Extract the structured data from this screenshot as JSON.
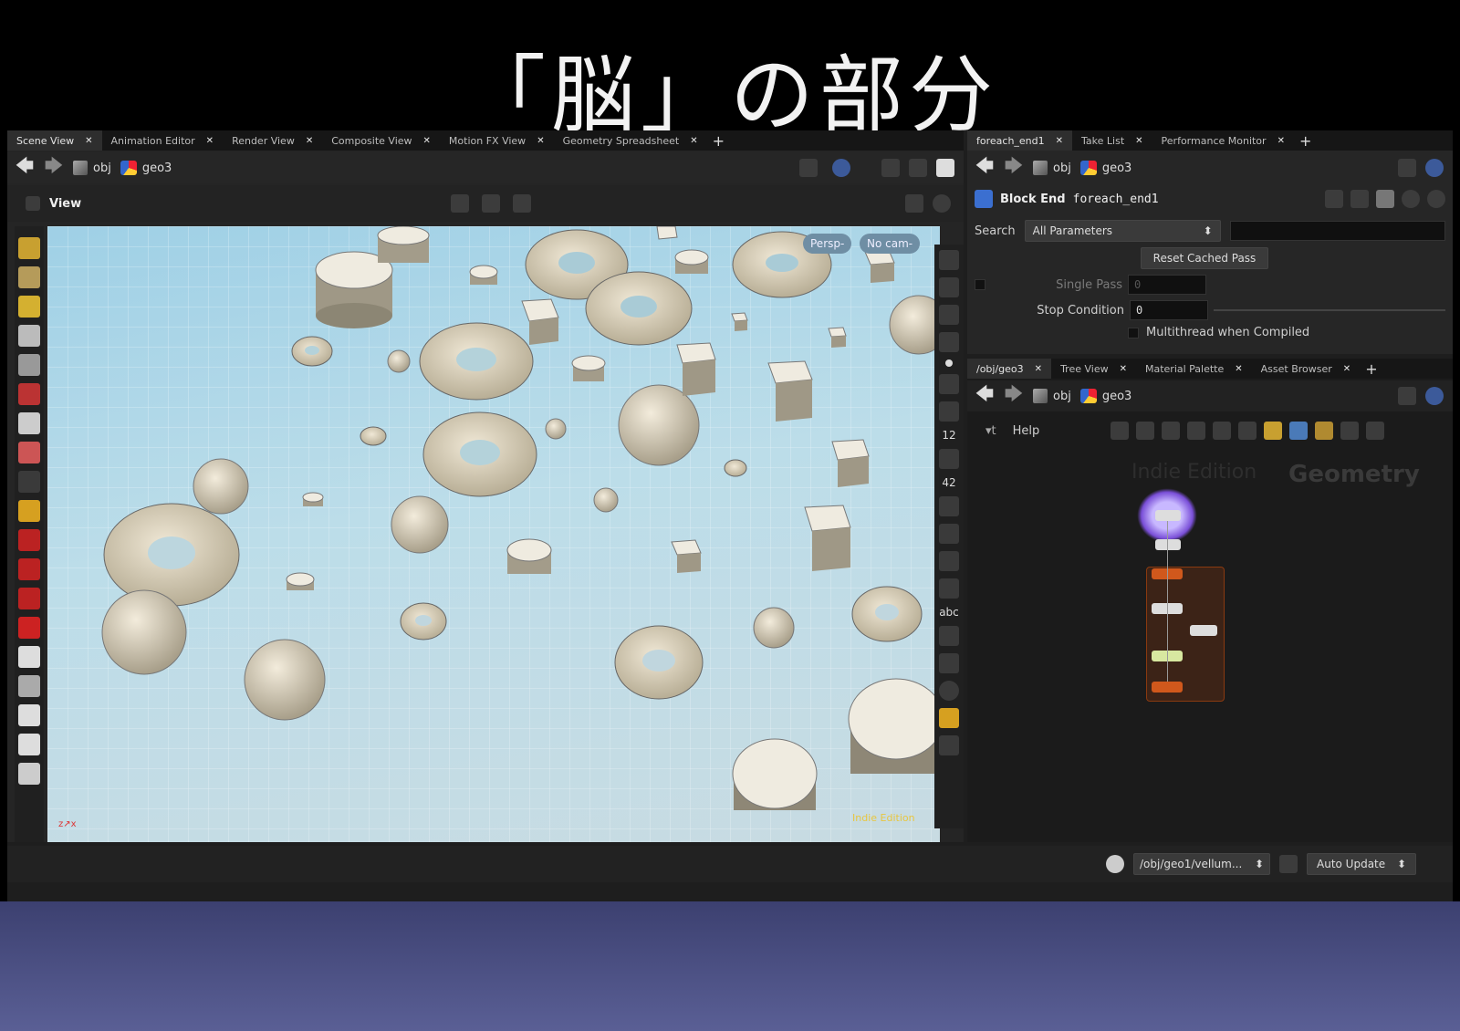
{
  "slide": {
    "title": "「脳」の部分"
  },
  "left_pane": {
    "tabs": [
      {
        "label": "Scene View",
        "active": true
      },
      {
        "label": "Animation Editor"
      },
      {
        "label": "Render View"
      },
      {
        "label": "Composite View"
      },
      {
        "label": "Motion FX View"
      },
      {
        "label": "Geometry Spreadsheet"
      }
    ],
    "path": [
      "obj",
      "geo3"
    ],
    "view_label": "View",
    "viewport": {
      "persp": "Persp-",
      "cam": "No cam-",
      "watermark": "Indie Edition"
    },
    "toolbar_right_text": [
      "12",
      "42",
      "abc"
    ]
  },
  "param_pane": {
    "tabs": [
      {
        "label": "foreach_end1",
        "active": true
      },
      {
        "label": "Take List"
      },
      {
        "label": "Performance Monitor"
      }
    ],
    "path": [
      "obj",
      "geo3"
    ],
    "node_type": "Block End",
    "node_name": "foreach_end1",
    "search_label": "Search",
    "search_value": "All Parameters",
    "reset_button": "Reset Cached Pass",
    "single_pass_label": "Single Pass",
    "single_pass_value": "0",
    "stop_condition_label": "Stop Condition",
    "stop_condition_value": "0",
    "multithread_label": "Multithread when Compiled"
  },
  "network_pane": {
    "tabs": [
      {
        "label": "/obj/geo3",
        "active": true
      },
      {
        "label": "Tree View"
      },
      {
        "label": "Material Palette"
      },
      {
        "label": "Asset Browser"
      }
    ],
    "path": [
      "obj",
      "geo3"
    ],
    "help_label": "Help",
    "watermark_edition": "Indie Edition",
    "watermark_context": "Geometry"
  },
  "statusbar": {
    "path": "/obj/geo1/vellum...",
    "update_mode": "Auto Update"
  },
  "colors": {
    "accent": "#5b8fd8",
    "viewport_top": "#9fd0e6",
    "node_orange": "#d0581c",
    "node_purple": "#7a4fd8"
  }
}
